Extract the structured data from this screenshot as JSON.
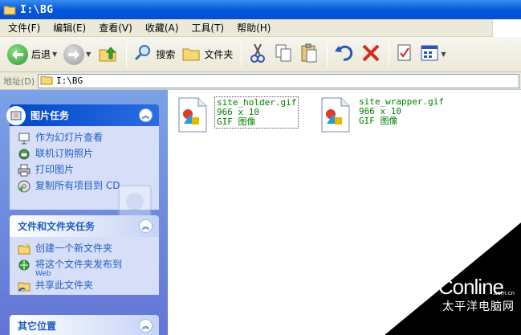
{
  "window": {
    "title": "I:\\BG"
  },
  "menu": [
    {
      "label": "文件(F)"
    },
    {
      "label": "编辑(E)"
    },
    {
      "label": "查看(V)"
    },
    {
      "label": "收藏(A)"
    },
    {
      "label": "工具(T)"
    },
    {
      "label": "帮助(H)"
    }
  ],
  "toolbar": {
    "back_label": "后退",
    "search_label": "搜索",
    "folders_label": "文件夹"
  },
  "address": {
    "label": "地址(D)",
    "value": "I:\\BG"
  },
  "taskpane": {
    "picture_tasks": {
      "title": "图片任务",
      "items": [
        {
          "label": "作为幻灯片查看"
        },
        {
          "label": "联机订购照片"
        },
        {
          "label": "打印图片"
        },
        {
          "label": "复制所有项目到 CD"
        }
      ]
    },
    "file_tasks": {
      "title": "文件和文件夹任务",
      "items": [
        {
          "label": "创建一个新文件夹"
        },
        {
          "label": "将这个文件夹发布到",
          "sub": "Web"
        },
        {
          "label": "共享此文件夹"
        }
      ]
    },
    "other_places": {
      "title": "其它位置"
    }
  },
  "files": [
    {
      "name": "site_holder.gif",
      "dims": "966 x 10",
      "type": "GIF 图像"
    },
    {
      "name": "site_wrapper.gif",
      "dims": "966 x 10",
      "type": "GIF 图像"
    }
  ],
  "watermark": {
    "logo": "PConline",
    "domain": ".com.cn",
    "cn": "太平洋电脑网"
  },
  "colors": {
    "title_bar": "#0a5fd8",
    "task_link": "#215dc6",
    "file_text": "#008000"
  }
}
